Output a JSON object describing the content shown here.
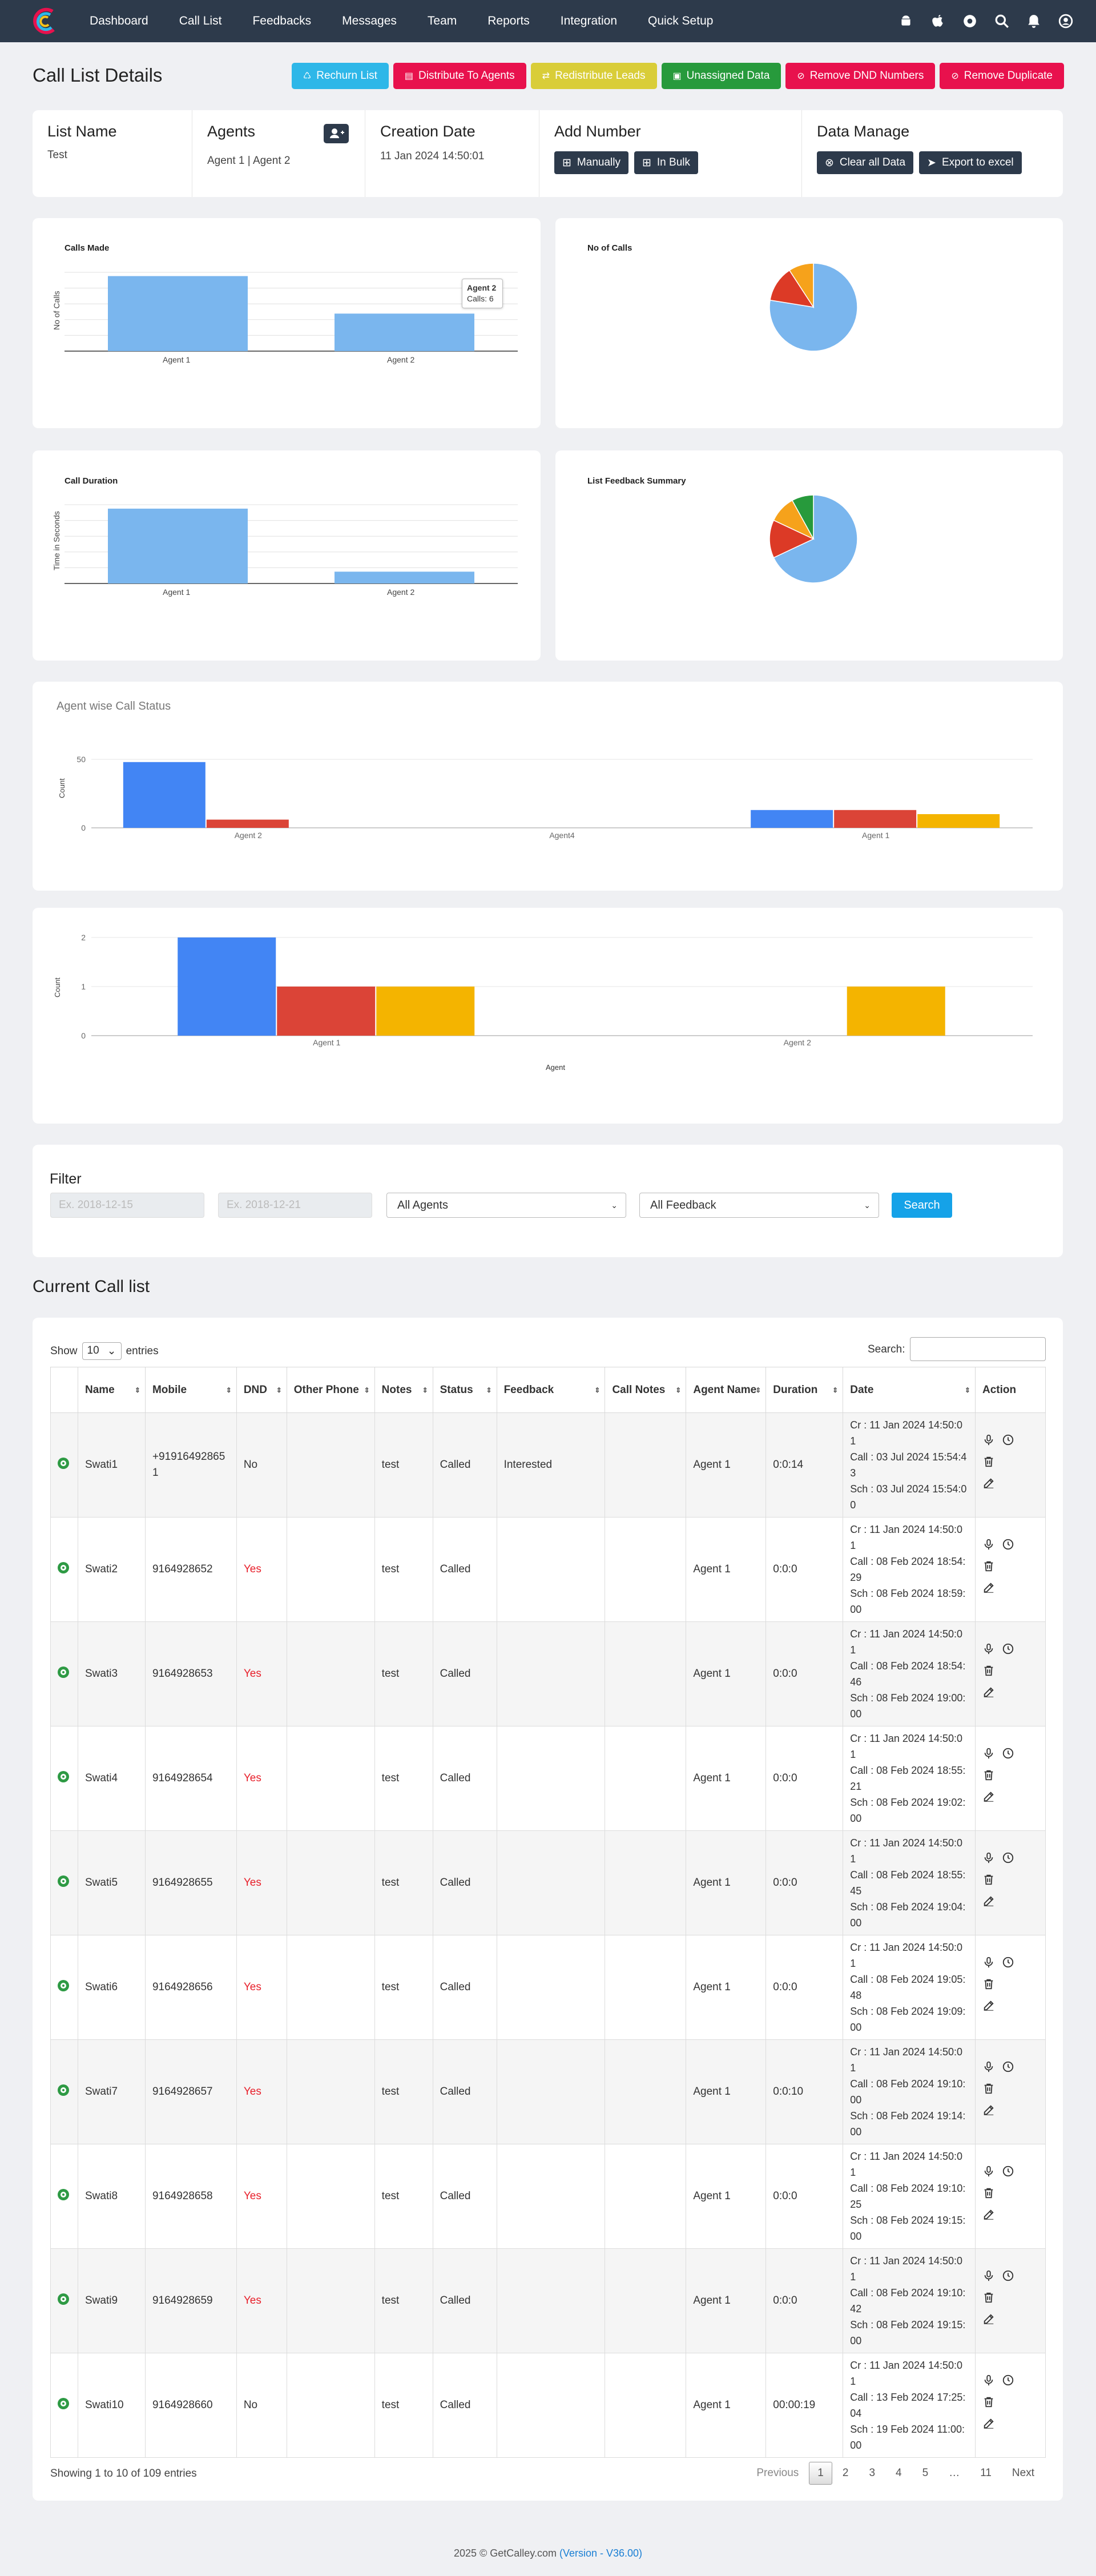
{
  "nav": {
    "items": [
      "Dashboard",
      "Call List",
      "Feedbacks",
      "Messages",
      "Team",
      "Reports",
      "Integration",
      "Quick Setup"
    ]
  },
  "page": {
    "title": "Call List Details"
  },
  "toolbar": [
    {
      "label": "Rechurn List",
      "color": "#2eb7e8",
      "icon": "recycle-icon"
    },
    {
      "label": "Distribute To Agents",
      "color": "#e8114d",
      "icon": "share-icon"
    },
    {
      "label": "Redistribute Leads",
      "color": "#d9cd38",
      "icon": "share-icon"
    },
    {
      "label": "Unassigned Data",
      "color": "#279a3c",
      "icon": "user-x-icon"
    },
    {
      "label": "Remove DND Numbers",
      "color": "#e8114d",
      "icon": "ban-icon"
    },
    {
      "label": "Remove Duplicate",
      "color": "#e8114d",
      "icon": "ban-icon"
    }
  ],
  "info": {
    "list_name_label": "List Name",
    "list_name": "Test",
    "agents_label": "Agents",
    "agents": "Agent 1 | Agent 2",
    "creation_label": "Creation Date",
    "creation": "11 Jan 2024 14:50:01",
    "add_label": "Add Number",
    "manually": "Manually",
    "bulk": "In Bulk",
    "manage_label": "Data Manage",
    "clear": "Clear all Data",
    "export": "Export to excel"
  },
  "chart_data": [
    {
      "type": "bar",
      "title": "Calls Made",
      "ylabel": "No of Calls",
      "categories": [
        "Agent 1",
        "Agent 2"
      ],
      "values": [
        10,
        5
      ],
      "tooltip": {
        "title": "Agent 2",
        "text": "Calls: 6"
      },
      "colors": [
        "#7ab6ee"
      ]
    },
    {
      "type": "pie",
      "title": "No of Calls",
      "values": [
        76,
        13,
        9
      ],
      "colors": [
        "#7ab6ee",
        "#dc3a26",
        "#f6a21b"
      ]
    },
    {
      "type": "bar",
      "title": "Call Duration",
      "ylabel": "Time in Seconds",
      "categories": [
        "Agent 1",
        "Agent 2"
      ],
      "values": [
        95,
        15
      ],
      "colors": [
        "#7ab6ee"
      ]
    },
    {
      "type": "pie",
      "title": "List Feedback Summary",
      "values": [
        68,
        14,
        10,
        8
      ],
      "colors": [
        "#7ab6ee",
        "#dc3a26",
        "#f6a21b",
        "#279a3c"
      ]
    },
    {
      "type": "bar",
      "title": "Agent wise Call Status",
      "ylabel": "Count",
      "ylim": [
        0,
        50
      ],
      "categories": [
        "Agent 2",
        "Agent4",
        "Agent 1"
      ],
      "series": [
        {
          "values": [
            48,
            0,
            13
          ],
          "color": "#4285f4"
        },
        {
          "values": [
            6,
            0,
            13
          ],
          "color": "#db4437"
        },
        {
          "values": [
            0,
            0,
            10
          ],
          "color": "#f4b400"
        }
      ]
    },
    {
      "type": "bar",
      "ylabel": "Count",
      "xlabel": "Agent",
      "ylim": [
        0,
        2
      ],
      "categories": [
        "Agent 1",
        "Agent 2"
      ],
      "series": [
        {
          "values": [
            2,
            0
          ],
          "color": "#4285f4"
        },
        {
          "values": [
            1,
            0
          ],
          "color": "#db4437"
        },
        {
          "values": [
            1,
            1
          ],
          "color": "#f4b400"
        }
      ]
    }
  ],
  "filter": {
    "title": "Filter",
    "start_ph": "Ex. 2018-12-15",
    "end_ph": "Ex. 2018-12-21",
    "agents": "All Agents",
    "feedback": "All Feedback",
    "search": "Search"
  },
  "list": {
    "title": "Current Call list",
    "show": "Show",
    "entries_val": "10",
    "entries": "entries",
    "search_label": "Search:"
  },
  "table": {
    "headers": [
      "Name",
      "Mobile",
      "DND",
      "Other Phone",
      "Notes",
      "Status",
      "Feedback",
      "Call Notes",
      "Agent Name",
      "Duration",
      "Date",
      "Action"
    ],
    "rows": [
      {
        "name": "Swati1",
        "mobile": "+919164928651",
        "dnd": "No",
        "notes": "test",
        "status": "Called",
        "feedback": "Interested",
        "agent": "Agent 1",
        "duration": "0:0:14",
        "date": "Cr : 11 Jan 2024 14:50:01\nCall : 03 Jul 2024 15:54:43\nSch : 03 Jul 2024 15:54:00"
      },
      {
        "name": "Swati2",
        "mobile": "9164928652",
        "dnd": "Yes",
        "notes": "test",
        "status": "Called",
        "feedback": "",
        "agent": "Agent 1",
        "duration": "0:0:0",
        "date": "Cr : 11 Jan 2024 14:50:01\nCall : 08 Feb 2024 18:54:29\nSch : 08 Feb 2024 18:59:00"
      },
      {
        "name": "Swati3",
        "mobile": "9164928653",
        "dnd": "Yes",
        "notes": "test",
        "status": "Called",
        "feedback": "",
        "agent": "Agent 1",
        "duration": "0:0:0",
        "date": "Cr : 11 Jan 2024 14:50:01\nCall : 08 Feb 2024 18:54:46\nSch : 08 Feb 2024 19:00:00"
      },
      {
        "name": "Swati4",
        "mobile": "9164928654",
        "dnd": "Yes",
        "notes": "test",
        "status": "Called",
        "feedback": "",
        "agent": "Agent 1",
        "duration": "0:0:0",
        "date": "Cr : 11 Jan 2024 14:50:01\nCall : 08 Feb 2024 18:55:21\nSch : 08 Feb 2024 19:02:00"
      },
      {
        "name": "Swati5",
        "mobile": "9164928655",
        "dnd": "Yes",
        "notes": "test",
        "status": "Called",
        "feedback": "",
        "agent": "Agent 1",
        "duration": "0:0:0",
        "date": "Cr : 11 Jan 2024 14:50:01\nCall : 08 Feb 2024 18:55:45\nSch : 08 Feb 2024 19:04:00"
      },
      {
        "name": "Swati6",
        "mobile": "9164928656",
        "dnd": "Yes",
        "notes": "test",
        "status": "Called",
        "feedback": "",
        "agent": "Agent 1",
        "duration": "0:0:0",
        "date": "Cr : 11 Jan 2024 14:50:01\nCall : 08 Feb 2024 19:05:48\nSch : 08 Feb 2024 19:09:00"
      },
      {
        "name": "Swati7",
        "mobile": "9164928657",
        "dnd": "Yes",
        "notes": "test",
        "status": "Called",
        "feedback": "",
        "agent": "Agent 1",
        "duration": "0:0:10",
        "date": "Cr : 11 Jan 2024 14:50:01\nCall : 08 Feb 2024 19:10:00\nSch : 08 Feb 2024 19:14:00"
      },
      {
        "name": "Swati8",
        "mobile": "9164928658",
        "dnd": "Yes",
        "notes": "test",
        "status": "Called",
        "feedback": "",
        "agent": "Agent 1",
        "duration": "0:0:0",
        "date": "Cr : 11 Jan 2024 14:50:01\nCall : 08 Feb 2024 19:10:25\nSch : 08 Feb 2024 19:15:00"
      },
      {
        "name": "Swati9",
        "mobile": "9164928659",
        "dnd": "Yes",
        "notes": "test",
        "status": "Called",
        "feedback": "",
        "agent": "Agent 1",
        "duration": "0:0:0",
        "date": "Cr : 11 Jan 2024 14:50:01\nCall : 08 Feb 2024 19:10:42\nSch : 08 Feb 2024 19:15:00"
      },
      {
        "name": "Swati10",
        "mobile": "9164928660",
        "dnd": "No",
        "notes": "test",
        "status": "Called",
        "feedback": "",
        "agent": "Agent 1",
        "duration": "00:00:19",
        "date": "Cr : 11 Jan 2024 14:50:01\nCall : 13 Feb 2024 17:25:04\nSch : 19 Feb 2024 11:00:00"
      }
    ]
  },
  "footer": {
    "showing": "Showing 1 to 10 of 109 entries",
    "prev": "Previous",
    "pages": [
      "1",
      "2",
      "3",
      "4",
      "5",
      "…",
      "11"
    ],
    "next": "Next",
    "copyright": "2025 © GetCalley.com ",
    "version": "(Version - V36.00)"
  }
}
